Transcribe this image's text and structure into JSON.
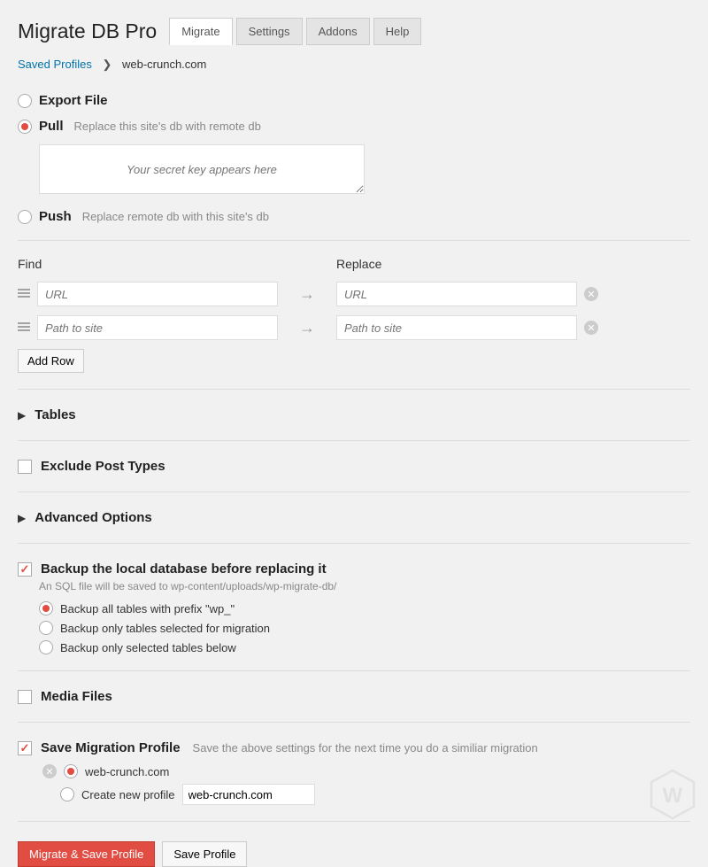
{
  "title": "Migrate DB Pro",
  "tabs": {
    "migrate": "Migrate",
    "settings": "Settings",
    "addons": "Addons",
    "help": "Help"
  },
  "breadcrumb": {
    "saved": "Saved Profiles",
    "current": "web-crunch.com"
  },
  "modes": {
    "export": "Export File",
    "pull": "Pull",
    "pull_desc": "Replace this site's db with remote db",
    "push": "Push",
    "push_desc": "Replace remote db with this site's db"
  },
  "secret_placeholder": "Your secret key appears here",
  "find_replace": {
    "find_header": "Find",
    "replace_header": "Replace",
    "rows": [
      {
        "find": "URL",
        "replace": "URL"
      },
      {
        "find": "Path to site",
        "replace": "Path to site"
      }
    ],
    "add_row": "Add Row"
  },
  "sections": {
    "tables": "Tables",
    "exclude_post_types": "Exclude Post Types",
    "advanced_options": "Advanced Options",
    "backup": {
      "title": "Backup the local database before replacing it",
      "desc": "An SQL file will be saved to wp-content/uploads/wp-migrate-db/",
      "opt1": "Backup all tables with prefix \"wp_\"",
      "opt2": "Backup only tables selected for migration",
      "opt3": "Backup only selected tables below"
    },
    "media_files": "Media Files",
    "save_profile": {
      "title": "Save Migration Profile",
      "desc": "Save the above settings for the next time you do a similiar migration",
      "existing": "web-crunch.com",
      "create_new": "Create new profile",
      "new_value": "web-crunch.com"
    }
  },
  "actions": {
    "primary": "Migrate & Save Profile",
    "secondary": "Save Profile"
  }
}
